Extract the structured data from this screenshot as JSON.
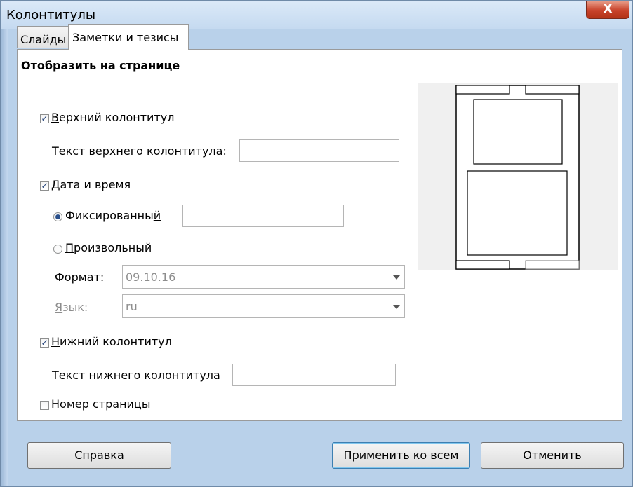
{
  "window": {
    "title": "Колонтитулы",
    "close_glyph": "X"
  },
  "tabs": [
    {
      "label": "Слайды",
      "active": false
    },
    {
      "label": "Заметки и тезисы",
      "active": true
    }
  ],
  "section_heading": "Отобразить на странице",
  "header_checkbox": {
    "pre": "",
    "ul": "В",
    "post": "ерхний колонтитул",
    "checked": true
  },
  "header_text": {
    "pre": "",
    "ul": "Т",
    "post": "екст верхнего колонтитула:",
    "value": ""
  },
  "datetime_checkbox": {
    "pre": "",
    "ul": "Д",
    "post": "ата и время",
    "checked": true
  },
  "fixed_radio": {
    "pre": "Фиксированны",
    "ul": "й",
    "post": "",
    "selected": true,
    "value": ""
  },
  "variable_radio": {
    "pre": "",
    "ul": "П",
    "post": "роизвольный",
    "selected": false
  },
  "format": {
    "pre": "",
    "ul": "Ф",
    "post": "ормат:",
    "value": "09.10.16"
  },
  "language": {
    "pre": "",
    "ul": "Я",
    "post": "зык:",
    "value": "ru"
  },
  "footer_checkbox": {
    "pre": "",
    "ul": "Н",
    "post": "ижний колонтитул",
    "checked": true
  },
  "footer_text": {
    "pre": "Текст нижнего ",
    "ul": "к",
    "post": "олонтитула",
    "value": ""
  },
  "page_number_checkbox": {
    "pre": "Номер ",
    "ul": "с",
    "post": "траницы",
    "checked": false
  },
  "buttons": {
    "help": {
      "pre": "",
      "ul": "С",
      "post": "правка"
    },
    "apply_all": {
      "pre": "Применить ",
      "ul": "к",
      "post": "о всем"
    },
    "cancel": {
      "label": "Отменить"
    }
  },
  "checkmark_glyph": "✓",
  "icons": {
    "close": "close-icon",
    "dropdown": "chevron-down-icon"
  },
  "colors": {
    "close_button": "#c8432b",
    "titlebar": "#c5daf0",
    "default_button_border": "#3c7fb1"
  }
}
